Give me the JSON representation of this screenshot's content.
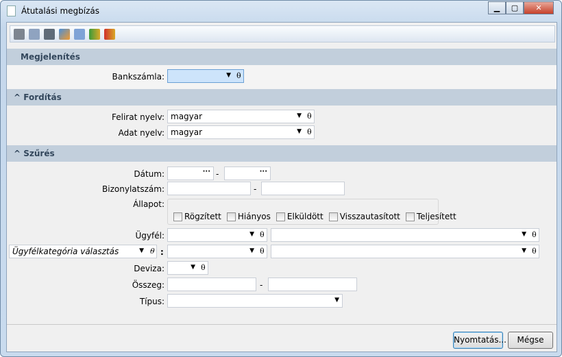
{
  "window": {
    "title": "Átutalási megbízás",
    "minimize": "▁",
    "maximize": "▢",
    "close": "✕"
  },
  "toolbar": [
    "printer-icon",
    "settings-doc-icon",
    "settings-pages-icon",
    "edit-icon",
    "calculator-icon",
    "coins-in-icon",
    "coins-out-icon"
  ],
  "sections": {
    "display": "Megjelenítés",
    "translation": "Fordítás",
    "filter": "Szűrés"
  },
  "collapse_glyph": "⌃",
  "fields": {
    "bankszamla": {
      "label": "Bankszámla:",
      "value": ""
    },
    "felirat": {
      "label": "Felirat nyelv:",
      "value": "magyar"
    },
    "adat": {
      "label": "Adat nyelv:",
      "value": "magyar"
    },
    "datum": {
      "label": "Dátum:",
      "sep": "-"
    },
    "bizonylat": {
      "label": "Bizonylatszám:",
      "sep": "-"
    },
    "allapot": {
      "label": "Állapot:",
      "options": [
        "Rögzített",
        "Hiányos",
        "Elküldött",
        "Visszautasított",
        "Teljesített"
      ]
    },
    "ugyfel": {
      "label": "Ügyfél:"
    },
    "kategoria": {
      "value": "Ügyfélkategória választás",
      "sep": ":"
    },
    "deviza": {
      "label": "Deviza:"
    },
    "osszeg": {
      "label": "Összeg:",
      "sep": "-"
    },
    "tipus": {
      "label": "Típus:"
    }
  },
  "glyphs": {
    "arrow": "▼",
    "clip": "⍬",
    "dots": "···"
  },
  "buttons": {
    "print": "Nyomtatás...",
    "cancel": "Mégse"
  }
}
